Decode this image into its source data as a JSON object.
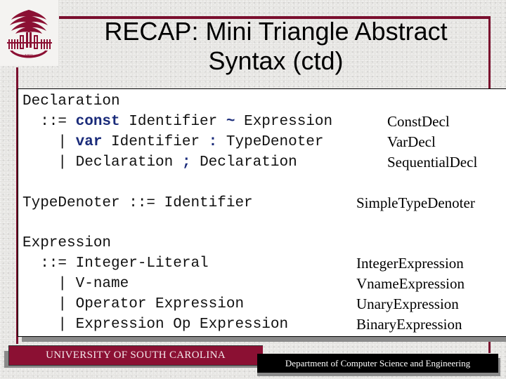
{
  "slide": {
    "title_line1": "RECAP: Mini Triangle Abstract",
    "title_line2": "Syntax (ctd)",
    "colors": {
      "maroon": "#7a0f2e",
      "keyword_blue": "#1a2b7a"
    },
    "logo": "university-palmetto-seal-icon",
    "logo_year": "1801"
  },
  "grammar": {
    "declaration": {
      "head": "Declaration",
      "lines": [
        {
          "prefix": "  ::= ",
          "parts": [
            [
              "kw",
              "const"
            ],
            [
              "t",
              " Identifier "
            ],
            [
              "kw",
              "~"
            ],
            [
              "t",
              " Expression"
            ]
          ],
          "ast": "ConstDecl"
        },
        {
          "prefix": "    | ",
          "parts": [
            [
              "kw",
              "var"
            ],
            [
              "t",
              " Identifier "
            ],
            [
              "kw",
              ":"
            ],
            [
              "t",
              " TypeDenoter"
            ]
          ],
          "ast": "VarDecl"
        },
        {
          "prefix": "    | ",
          "parts": [
            [
              "t",
              "Declaration "
            ],
            [
              "kw",
              ";"
            ],
            [
              "t",
              " Declaration"
            ]
          ],
          "ast": "SequentialDecl"
        }
      ]
    },
    "typedenoter": {
      "text": "TypeDenoter ::= Identifier",
      "ast": "SimpleTypeDenoter"
    },
    "expression": {
      "head": "Expression",
      "lines": [
        {
          "text": "  ::= Integer-Literal",
          "ast": "IntegerExpression"
        },
        {
          "text": "    | V-name",
          "ast": "VnameExpression"
        },
        {
          "text": "    | Operator Expression",
          "ast": "UnaryExpression"
        },
        {
          "text": "    | Expression Op Expression",
          "ast": "BinaryExpression"
        }
      ]
    }
  },
  "footer": {
    "university": "UNIVERSITY OF SOUTH CAROLINA",
    "department": "Department of Computer Science and Engineering"
  }
}
